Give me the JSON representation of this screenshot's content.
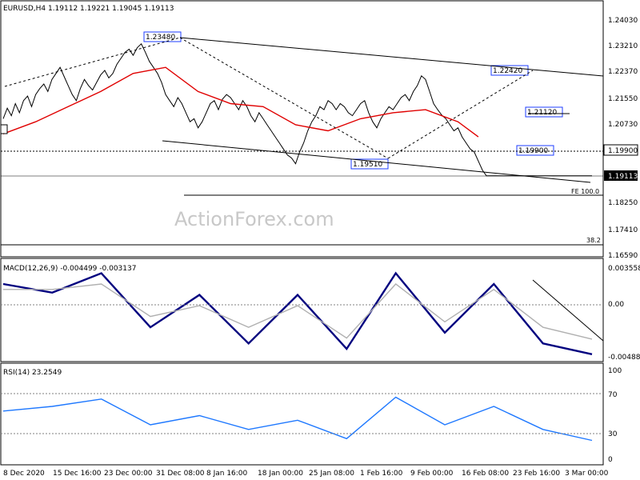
{
  "watermark": "ActionForex.com",
  "chart_data": [
    {
      "type": "line",
      "panel": "price",
      "title": "EURUSD,H4  1.19112 1.19221 1.19045 1.19113",
      "symbol": "EURUSD",
      "timeframe": "H4",
      "ohlc": {
        "open": 1.19112,
        "high": 1.19221,
        "low": 1.19045,
        "close": 1.19113
      },
      "y_ticks": [
        "1.24030",
        "1.23210",
        "1.22370",
        "1.21550",
        "1.20730",
        "1.19900",
        "1.19113",
        "1.18250",
        "1.17410",
        "1.16590"
      ],
      "ylim": [
        1.1659,
        1.244
      ],
      "x_ticks": [
        "8 Dec 2020",
        "15 Dec 16:00",
        "23 Dec 00:00",
        "31 Dec 08:00",
        "8 Jan 16:00",
        "18 Jan 00:00",
        "25 Jan 08:00",
        "1 Feb 16:00",
        "9 Feb 00:00",
        "16 Feb 08:00",
        "23 Feb 16:00",
        "3 Mar 00:00"
      ],
      "series": [
        {
          "color": "#000000",
          "x": [
            0,
            1,
            2,
            3,
            4,
            5,
            6,
            7,
            8,
            9,
            10,
            11,
            12,
            13,
            14,
            15,
            16,
            17,
            18,
            19,
            20,
            21,
            22,
            23,
            24,
            25,
            26,
            27,
            28,
            29,
            30,
            31,
            32,
            33,
            34,
            35,
            36,
            37,
            38,
            39,
            40,
            41,
            42,
            43,
            44,
            45,
            46,
            47,
            48,
            49,
            50,
            51,
            52,
            53,
            54,
            55,
            56,
            57,
            58,
            59,
            60,
            61,
            62,
            63,
            64,
            65,
            66,
            67,
            68,
            69,
            70,
            71,
            72,
            73,
            74,
            75,
            76,
            77,
            78,
            79,
            80,
            81,
            82,
            83,
            84,
            85,
            86,
            87,
            88,
            89,
            90,
            91,
            92,
            93,
            94,
            95,
            96,
            97,
            98,
            99,
            100,
            101,
            102,
            103,
            104,
            105,
            106,
            107,
            108,
            109,
            110,
            111,
            112,
            113,
            114,
            115,
            116,
            117,
            118,
            119,
            120,
            121,
            122,
            123,
            124,
            125,
            126,
            127,
            128,
            129,
            130,
            131,
            132,
            133,
            134,
            135,
            136,
            137,
            138,
            139,
            140,
            141,
            142,
            143,
            144,
            145
          ],
          "values": [
            1.21,
            1.2135,
            1.211,
            1.215,
            1.212,
            1.216,
            1.2175,
            1.214,
            1.218,
            1.22,
            1.2215,
            1.219,
            1.223,
            1.225,
            1.227,
            1.224,
            1.221,
            1.218,
            1.216,
            1.22,
            1.223,
            1.221,
            1.2195,
            1.222,
            1.2245,
            1.226,
            1.2235,
            1.225,
            1.228,
            1.23,
            1.232,
            1.233,
            1.231,
            1.2335,
            1.2348,
            1.232,
            1.229,
            1.227,
            1.225,
            1.222,
            1.218,
            1.216,
            1.214,
            1.217,
            1.215,
            1.212,
            1.209,
            1.21,
            1.207,
            1.209,
            1.212,
            1.215,
            1.216,
            1.213,
            1.2165,
            1.218,
            1.217,
            1.215,
            1.213,
            1.216,
            1.214,
            1.211,
            1.209,
            1.212,
            1.21,
            1.208,
            1.206,
            1.204,
            1.202,
            1.2,
            1.198,
            1.197,
            1.1951,
            1.199,
            1.202,
            1.206,
            1.209,
            1.211,
            1.214,
            1.213,
            1.216,
            1.215,
            1.213,
            1.215,
            1.214,
            1.212,
            1.211,
            1.213,
            1.215,
            1.216,
            1.212,
            1.209,
            1.207,
            1.21,
            1.212,
            1.214,
            1.213,
            1.215,
            1.217,
            1.218,
            1.216,
            1.219,
            1.221,
            1.2242,
            1.223,
            1.219,
            1.215,
            1.213,
            1.2112,
            1.21,
            1.208,
            1.206,
            1.207,
            1.204,
            1.202,
            1.2,
            1.199,
            1.196,
            1.193,
            1.1911,
            1.1911,
            1.1911,
            1.1911,
            1.1911,
            1.1911,
            1.1911,
            1.1911,
            1.1911,
            1.1911,
            1.1911,
            1.1911,
            1.1911,
            1.1911,
            1.1911,
            1.1911,
            1.1911,
            1.1911,
            1.1911,
            1.1911,
            1.1911,
            1.1911,
            1.1911,
            1.1911,
            1.1911,
            1.1911,
            1.1911
          ]
        },
        {
          "color": "#e00000",
          "x": [
            0,
            8,
            16,
            24,
            32,
            40,
            48,
            56,
            64,
            72,
            80,
            88,
            96,
            104,
            112,
            117
          ],
          "values": [
            1.205,
            1.209,
            1.214,
            1.219,
            1.225,
            1.227,
            1.219,
            1.215,
            1.214,
            1.208,
            1.206,
            1.21,
            1.212,
            1.213,
            1.209,
            1.204
          ]
        }
      ],
      "annotations": [
        "1.23480",
        "1.22420",
        "1.21120",
        "1.19900",
        "1.19510",
        "FE 100.0",
        "38.2",
        "1.19900",
        "1.19113"
      ],
      "levels": {
        "hline_1_19900": 1.199,
        "fe100": 1.186,
        "fib382": 1.169
      }
    },
    {
      "type": "line",
      "panel": "macd",
      "title": "MACD(12,26,9) -0.004499 -0.003137",
      "y_ticks": [
        "0.003558",
        "0.00",
        "-0.004882"
      ],
      "ylim": [
        -0.004882,
        0.003558
      ],
      "series": [
        {
          "color": "#00007f",
          "x": [
            0,
            10,
            20,
            30,
            40,
            50,
            60,
            70,
            80,
            90,
            100,
            110,
            120
          ],
          "values": [
            0.002,
            0.0012,
            0.003,
            -0.002,
            0.001,
            -0.0035,
            0.001,
            -0.004,
            0.003,
            -0.0025,
            0.002,
            -0.0035,
            -0.0045
          ]
        },
        {
          "color": "#b0b0b0",
          "x": [
            0,
            10,
            20,
            30,
            40,
            50,
            60,
            70,
            80,
            90,
            100,
            110,
            120
          ],
          "values": [
            0.0015,
            0.0015,
            0.002,
            -0.001,
            0.0,
            -0.002,
            0.0,
            -0.003,
            0.002,
            -0.0015,
            0.0015,
            -0.002,
            -0.0031
          ]
        }
      ]
    },
    {
      "type": "line",
      "panel": "rsi",
      "title": "RSI(14) 23.2549",
      "y_ticks": [
        "100",
        "70",
        "30",
        "0"
      ],
      "ylim": [
        0,
        100
      ],
      "series": [
        {
          "color": "#1e78ff",
          "x": [
            0,
            10,
            20,
            30,
            40,
            50,
            60,
            70,
            80,
            90,
            100,
            110,
            120
          ],
          "values": [
            55,
            60,
            68,
            40,
            50,
            35,
            45,
            25,
            70,
            40,
            60,
            35,
            23
          ]
        }
      ]
    }
  ]
}
